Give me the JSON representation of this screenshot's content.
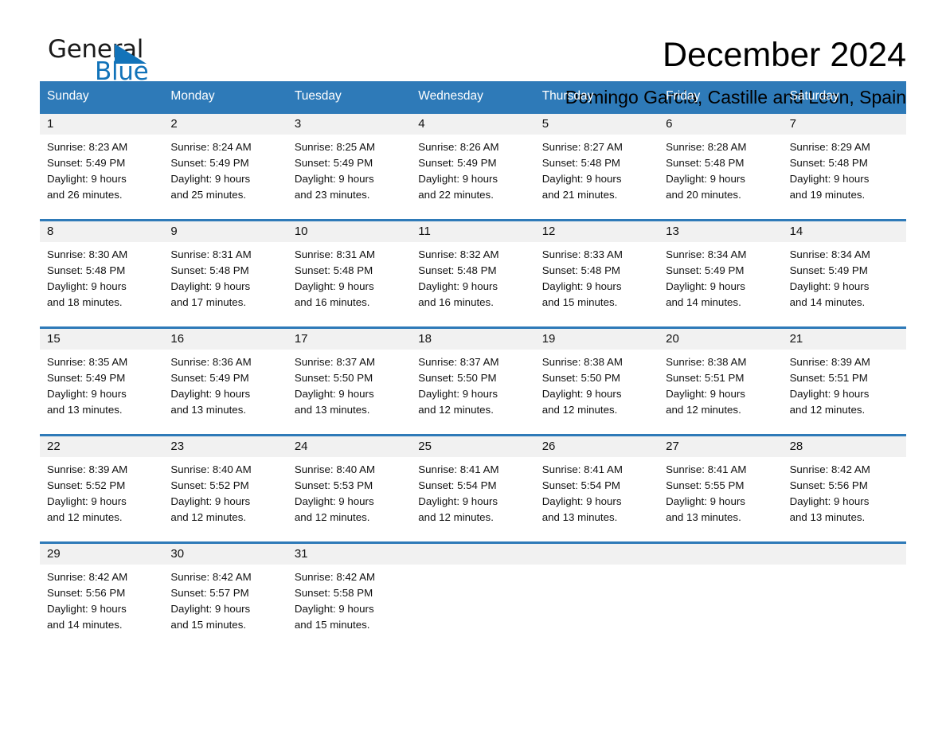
{
  "brand": {
    "name_part1": "General",
    "name_part2": "Blue",
    "logo_icon": "triangle-icon",
    "accent_color": "#1273b9"
  },
  "header": {
    "month_title": "December 2024",
    "location": "Domingo Garcia, Castille and Leon, Spain"
  },
  "calendar": {
    "header_bg": "#2e7ab8",
    "row_border": "#2e7ab8",
    "day_band_bg": "#f1f1f1",
    "weekdays": [
      "Sunday",
      "Monday",
      "Tuesday",
      "Wednesday",
      "Thursday",
      "Friday",
      "Saturday"
    ],
    "weeks": [
      {
        "days": [
          {
            "num": "1",
            "sunrise": "Sunrise: 8:23 AM",
            "sunset": "Sunset: 5:49 PM",
            "daylight_line1": "Daylight: 9 hours",
            "daylight_line2": "and 26 minutes."
          },
          {
            "num": "2",
            "sunrise": "Sunrise: 8:24 AM",
            "sunset": "Sunset: 5:49 PM",
            "daylight_line1": "Daylight: 9 hours",
            "daylight_line2": "and 25 minutes."
          },
          {
            "num": "3",
            "sunrise": "Sunrise: 8:25 AM",
            "sunset": "Sunset: 5:49 PM",
            "daylight_line1": "Daylight: 9 hours",
            "daylight_line2": "and 23 minutes."
          },
          {
            "num": "4",
            "sunrise": "Sunrise: 8:26 AM",
            "sunset": "Sunset: 5:49 PM",
            "daylight_line1": "Daylight: 9 hours",
            "daylight_line2": "and 22 minutes."
          },
          {
            "num": "5",
            "sunrise": "Sunrise: 8:27 AM",
            "sunset": "Sunset: 5:48 PM",
            "daylight_line1": "Daylight: 9 hours",
            "daylight_line2": "and 21 minutes."
          },
          {
            "num": "6",
            "sunrise": "Sunrise: 8:28 AM",
            "sunset": "Sunset: 5:48 PM",
            "daylight_line1": "Daylight: 9 hours",
            "daylight_line2": "and 20 minutes."
          },
          {
            "num": "7",
            "sunrise": "Sunrise: 8:29 AM",
            "sunset": "Sunset: 5:48 PM",
            "daylight_line1": "Daylight: 9 hours",
            "daylight_line2": "and 19 minutes."
          }
        ]
      },
      {
        "days": [
          {
            "num": "8",
            "sunrise": "Sunrise: 8:30 AM",
            "sunset": "Sunset: 5:48 PM",
            "daylight_line1": "Daylight: 9 hours",
            "daylight_line2": "and 18 minutes."
          },
          {
            "num": "9",
            "sunrise": "Sunrise: 8:31 AM",
            "sunset": "Sunset: 5:48 PM",
            "daylight_line1": "Daylight: 9 hours",
            "daylight_line2": "and 17 minutes."
          },
          {
            "num": "10",
            "sunrise": "Sunrise: 8:31 AM",
            "sunset": "Sunset: 5:48 PM",
            "daylight_line1": "Daylight: 9 hours",
            "daylight_line2": "and 16 minutes."
          },
          {
            "num": "11",
            "sunrise": "Sunrise: 8:32 AM",
            "sunset": "Sunset: 5:48 PM",
            "daylight_line1": "Daylight: 9 hours",
            "daylight_line2": "and 16 minutes."
          },
          {
            "num": "12",
            "sunrise": "Sunrise: 8:33 AM",
            "sunset": "Sunset: 5:48 PM",
            "daylight_line1": "Daylight: 9 hours",
            "daylight_line2": "and 15 minutes."
          },
          {
            "num": "13",
            "sunrise": "Sunrise: 8:34 AM",
            "sunset": "Sunset: 5:49 PM",
            "daylight_line1": "Daylight: 9 hours",
            "daylight_line2": "and 14 minutes."
          },
          {
            "num": "14",
            "sunrise": "Sunrise: 8:34 AM",
            "sunset": "Sunset: 5:49 PM",
            "daylight_line1": "Daylight: 9 hours",
            "daylight_line2": "and 14 minutes."
          }
        ]
      },
      {
        "days": [
          {
            "num": "15",
            "sunrise": "Sunrise: 8:35 AM",
            "sunset": "Sunset: 5:49 PM",
            "daylight_line1": "Daylight: 9 hours",
            "daylight_line2": "and 13 minutes."
          },
          {
            "num": "16",
            "sunrise": "Sunrise: 8:36 AM",
            "sunset": "Sunset: 5:49 PM",
            "daylight_line1": "Daylight: 9 hours",
            "daylight_line2": "and 13 minutes."
          },
          {
            "num": "17",
            "sunrise": "Sunrise: 8:37 AM",
            "sunset": "Sunset: 5:50 PM",
            "daylight_line1": "Daylight: 9 hours",
            "daylight_line2": "and 13 minutes."
          },
          {
            "num": "18",
            "sunrise": "Sunrise: 8:37 AM",
            "sunset": "Sunset: 5:50 PM",
            "daylight_line1": "Daylight: 9 hours",
            "daylight_line2": "and 12 minutes."
          },
          {
            "num": "19",
            "sunrise": "Sunrise: 8:38 AM",
            "sunset": "Sunset: 5:50 PM",
            "daylight_line1": "Daylight: 9 hours",
            "daylight_line2": "and 12 minutes."
          },
          {
            "num": "20",
            "sunrise": "Sunrise: 8:38 AM",
            "sunset": "Sunset: 5:51 PM",
            "daylight_line1": "Daylight: 9 hours",
            "daylight_line2": "and 12 minutes."
          },
          {
            "num": "21",
            "sunrise": "Sunrise: 8:39 AM",
            "sunset": "Sunset: 5:51 PM",
            "daylight_line1": "Daylight: 9 hours",
            "daylight_line2": "and 12 minutes."
          }
        ]
      },
      {
        "days": [
          {
            "num": "22",
            "sunrise": "Sunrise: 8:39 AM",
            "sunset": "Sunset: 5:52 PM",
            "daylight_line1": "Daylight: 9 hours",
            "daylight_line2": "and 12 minutes."
          },
          {
            "num": "23",
            "sunrise": "Sunrise: 8:40 AM",
            "sunset": "Sunset: 5:52 PM",
            "daylight_line1": "Daylight: 9 hours",
            "daylight_line2": "and 12 minutes."
          },
          {
            "num": "24",
            "sunrise": "Sunrise: 8:40 AM",
            "sunset": "Sunset: 5:53 PM",
            "daylight_line1": "Daylight: 9 hours",
            "daylight_line2": "and 12 minutes."
          },
          {
            "num": "25",
            "sunrise": "Sunrise: 8:41 AM",
            "sunset": "Sunset: 5:54 PM",
            "daylight_line1": "Daylight: 9 hours",
            "daylight_line2": "and 12 minutes."
          },
          {
            "num": "26",
            "sunrise": "Sunrise: 8:41 AM",
            "sunset": "Sunset: 5:54 PM",
            "daylight_line1": "Daylight: 9 hours",
            "daylight_line2": "and 13 minutes."
          },
          {
            "num": "27",
            "sunrise": "Sunrise: 8:41 AM",
            "sunset": "Sunset: 5:55 PM",
            "daylight_line1": "Daylight: 9 hours",
            "daylight_line2": "and 13 minutes."
          },
          {
            "num": "28",
            "sunrise": "Sunrise: 8:42 AM",
            "sunset": "Sunset: 5:56 PM",
            "daylight_line1": "Daylight: 9 hours",
            "daylight_line2": "and 13 minutes."
          }
        ]
      },
      {
        "days": [
          {
            "num": "29",
            "sunrise": "Sunrise: 8:42 AM",
            "sunset": "Sunset: 5:56 PM",
            "daylight_line1": "Daylight: 9 hours",
            "daylight_line2": "and 14 minutes."
          },
          {
            "num": "30",
            "sunrise": "Sunrise: 8:42 AM",
            "sunset": "Sunset: 5:57 PM",
            "daylight_line1": "Daylight: 9 hours",
            "daylight_line2": "and 15 minutes."
          },
          {
            "num": "31",
            "sunrise": "Sunrise: 8:42 AM",
            "sunset": "Sunset: 5:58 PM",
            "daylight_line1": "Daylight: 9 hours",
            "daylight_line2": "and 15 minutes."
          },
          {
            "num": "",
            "sunrise": "",
            "sunset": "",
            "daylight_line1": "",
            "daylight_line2": ""
          },
          {
            "num": "",
            "sunrise": "",
            "sunset": "",
            "daylight_line1": "",
            "daylight_line2": ""
          },
          {
            "num": "",
            "sunrise": "",
            "sunset": "",
            "daylight_line1": "",
            "daylight_line2": ""
          },
          {
            "num": "",
            "sunrise": "",
            "sunset": "",
            "daylight_line1": "",
            "daylight_line2": ""
          }
        ]
      }
    ]
  }
}
